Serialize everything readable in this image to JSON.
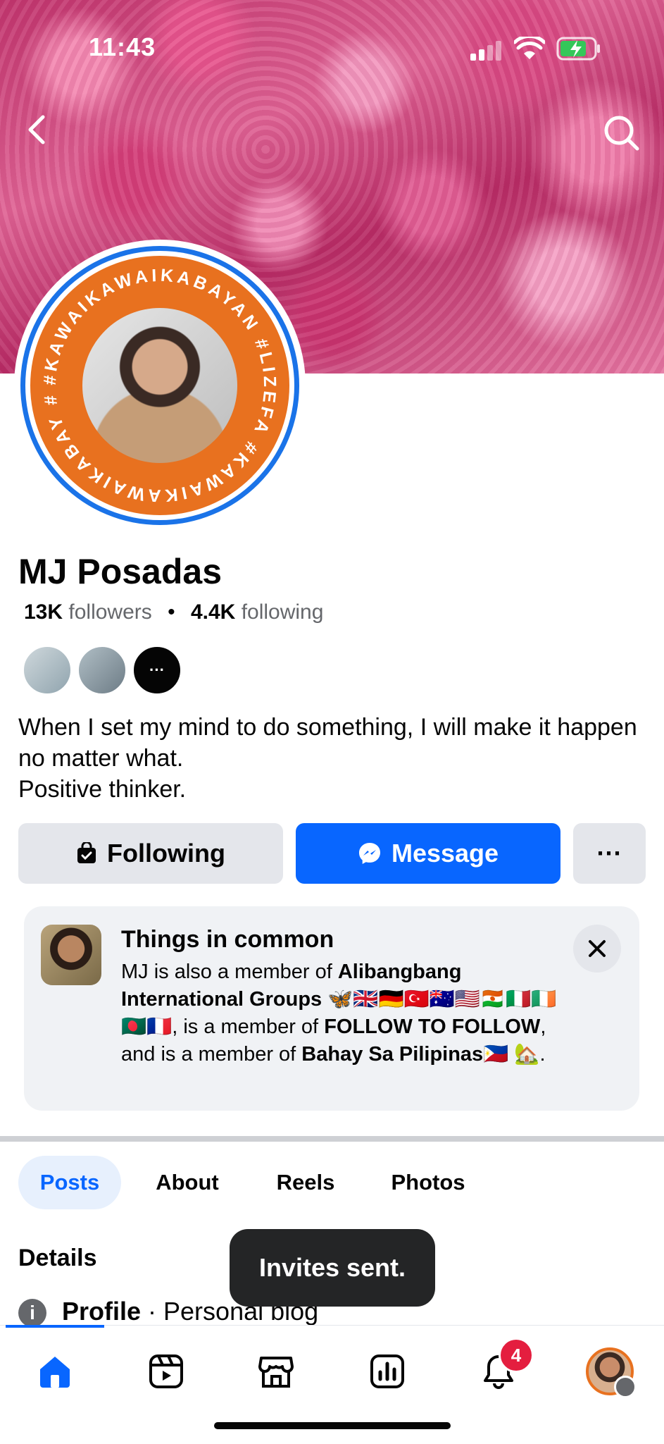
{
  "status_bar": {
    "time": "11:43"
  },
  "profile": {
    "name": "MJ Posadas",
    "followers_count": "13K",
    "followers_label": "followers",
    "following_count": "4.4K",
    "following_label": "following",
    "bio_line1": "When I set my mind to do something, I will make it happen no matter what.",
    "bio_line2": "Positive thinker.",
    "frame_text": "#KAWAIKAWAIKABAYAN #LIZEFA #KAWAIKAWAIKABAY #LIZEFA"
  },
  "actions": {
    "following_label": "Following",
    "message_label": "Message",
    "more_label": "···"
  },
  "common_card": {
    "title": "Things in common",
    "text_intro": "MJ is also a member of ",
    "group1": "Alibangbang International Groups",
    "group1_emoji": " 🦋🇬🇧🇩🇪🇹🇷🇦🇺🇺🇸🇳🇪🇮🇹🇮🇪🇧🇩🇫🇷",
    "sep1": ", is a member of ",
    "group2": "FOLLOW TO FOLLOW",
    "sep2": ", and is a member of ",
    "group3": "Bahay Sa Pilipinas",
    "group3_emoji": "🇵🇭 🏡",
    "end": "."
  },
  "tabs": [
    {
      "label": "Posts",
      "active": true
    },
    {
      "label": "About"
    },
    {
      "label": "Reels"
    },
    {
      "label": "Photos"
    }
  ],
  "details": {
    "heading": "Details",
    "profile_label": "Profile",
    "profile_type": " · Personal blog"
  },
  "toast": "Invites sent.",
  "bottom_nav": {
    "notifications_badge": "4",
    "icons": [
      "home-icon",
      "video-icon",
      "marketplace-icon",
      "dashboard-icon",
      "bell-icon",
      "profile-avatar"
    ]
  },
  "colors": {
    "accent": "#0866ff",
    "badge": "#e41e3f",
    "frame_orange": "#e8711f"
  }
}
